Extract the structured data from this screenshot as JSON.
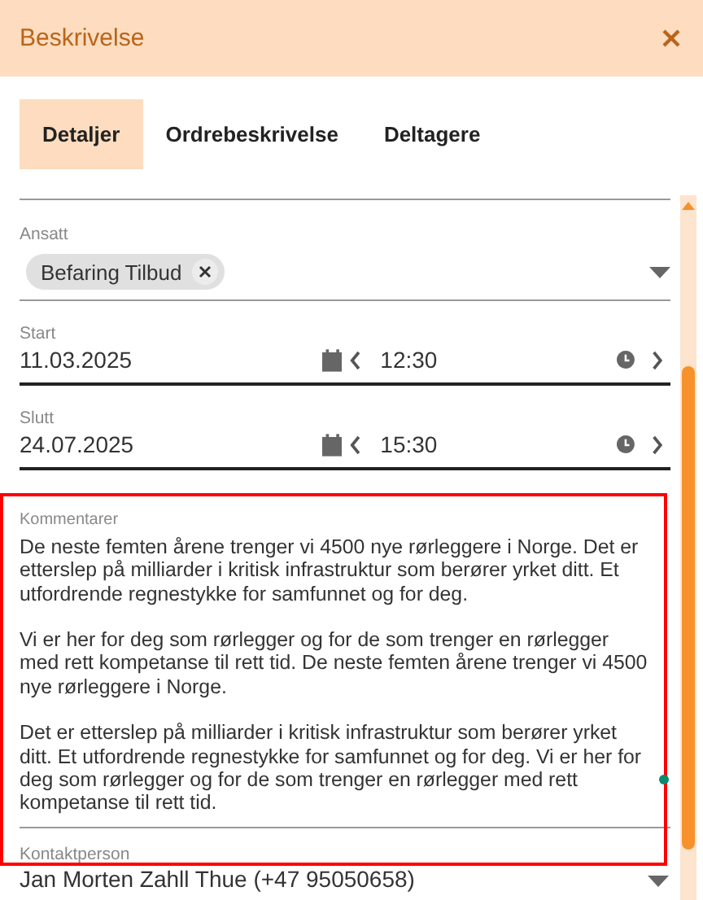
{
  "dialog": {
    "title": "Beskrivelse"
  },
  "tabs": [
    {
      "label": "Detaljer",
      "selected": true
    },
    {
      "label": "Ordrebeskrivelse",
      "selected": false
    },
    {
      "label": "Deltagere",
      "selected": false
    }
  ],
  "employee": {
    "label": "Ansatt",
    "chips": [
      {
        "label": "Befaring Tilbud"
      }
    ]
  },
  "times": [
    {
      "label": "Start",
      "date": "11.03.2025",
      "time": "12:30"
    },
    {
      "label": "Slutt",
      "date": "24.07.2025",
      "time": "15:30"
    }
  ],
  "comments": {
    "label": "Kommentarer",
    "annotated": true,
    "paragraphs": [
      "De neste femten årene trenger vi 4500 nye rørleggere i Norge. Det er etterslep på milliarder i kritisk infrastruktur som berører yrket ditt. Et utfordrende regnestykke for samfunnet og for deg.",
      "Vi er her for deg som rørlegger og for de som trenger en rørlegger med rett kompetanse til rett tid.  De neste femten årene trenger vi 4500 nye rørleggere i Norge.",
      "Det er etterslep på milliarder i kritisk infrastruktur som berører yrket ditt. Et utfordrende regnestykke for samfunnet og for deg. Vi er her for deg som rørlegger og for de som trenger en rørlegger med rett kompetanse til rett tid."
    ]
  },
  "contact": {
    "label": "Kontaktperson",
    "value": "Jan Morten Zahll Thue (+47 95050658)"
  }
}
